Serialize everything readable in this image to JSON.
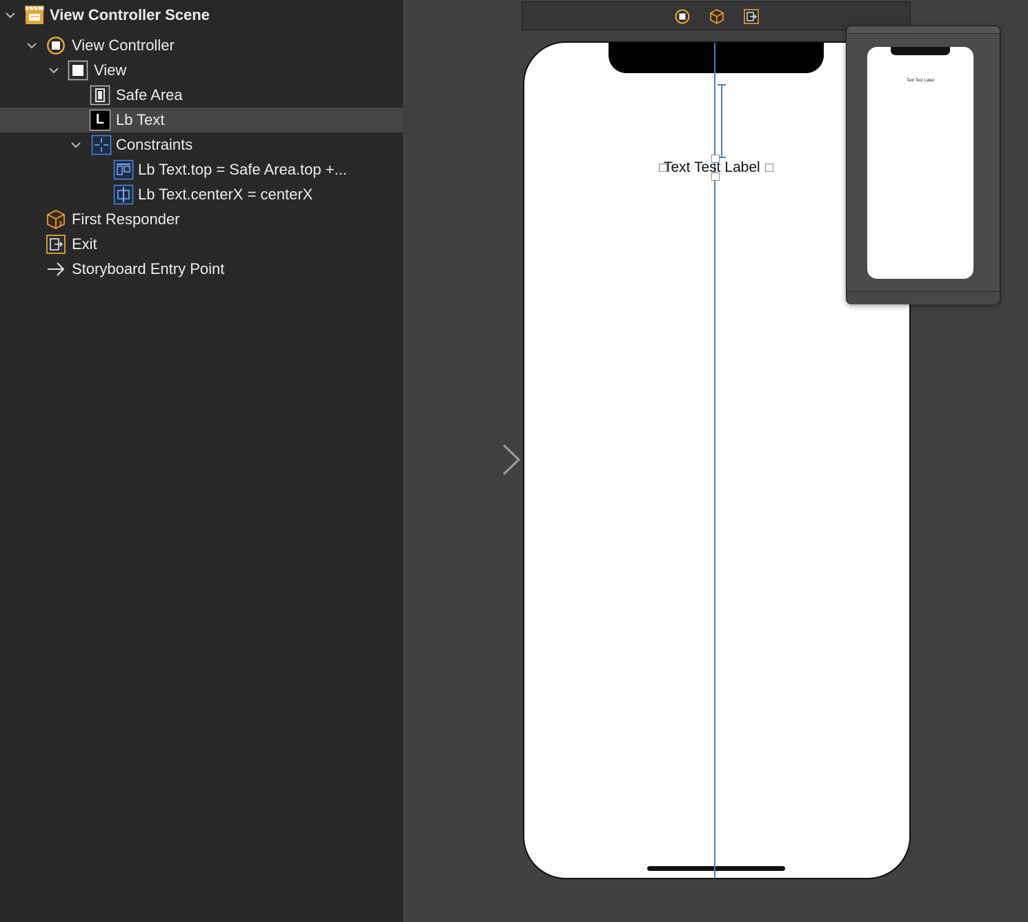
{
  "outline": {
    "scene_title": "View Controller Scene",
    "view_controller": "View Controller",
    "view": "View",
    "safe_area": "Safe Area",
    "lb_text": "Lb Text",
    "constraints": "Constraints",
    "constraint_top": "Lb Text.top = Safe Area.top +...",
    "constraint_centerx": "Lb Text.centerX = centerX",
    "first_responder": "First Responder",
    "exit": "Exit",
    "entry_point": "Storyboard Entry Point",
    "label_icon_glyph": "L"
  },
  "canvas": {
    "label_text": "Text Test Label",
    "preview_label_text": "Text Test Label"
  },
  "colors": {
    "accent_orange": "#e7a53a",
    "constraint_blue": "#4a7ec7",
    "selection": "#464646"
  }
}
